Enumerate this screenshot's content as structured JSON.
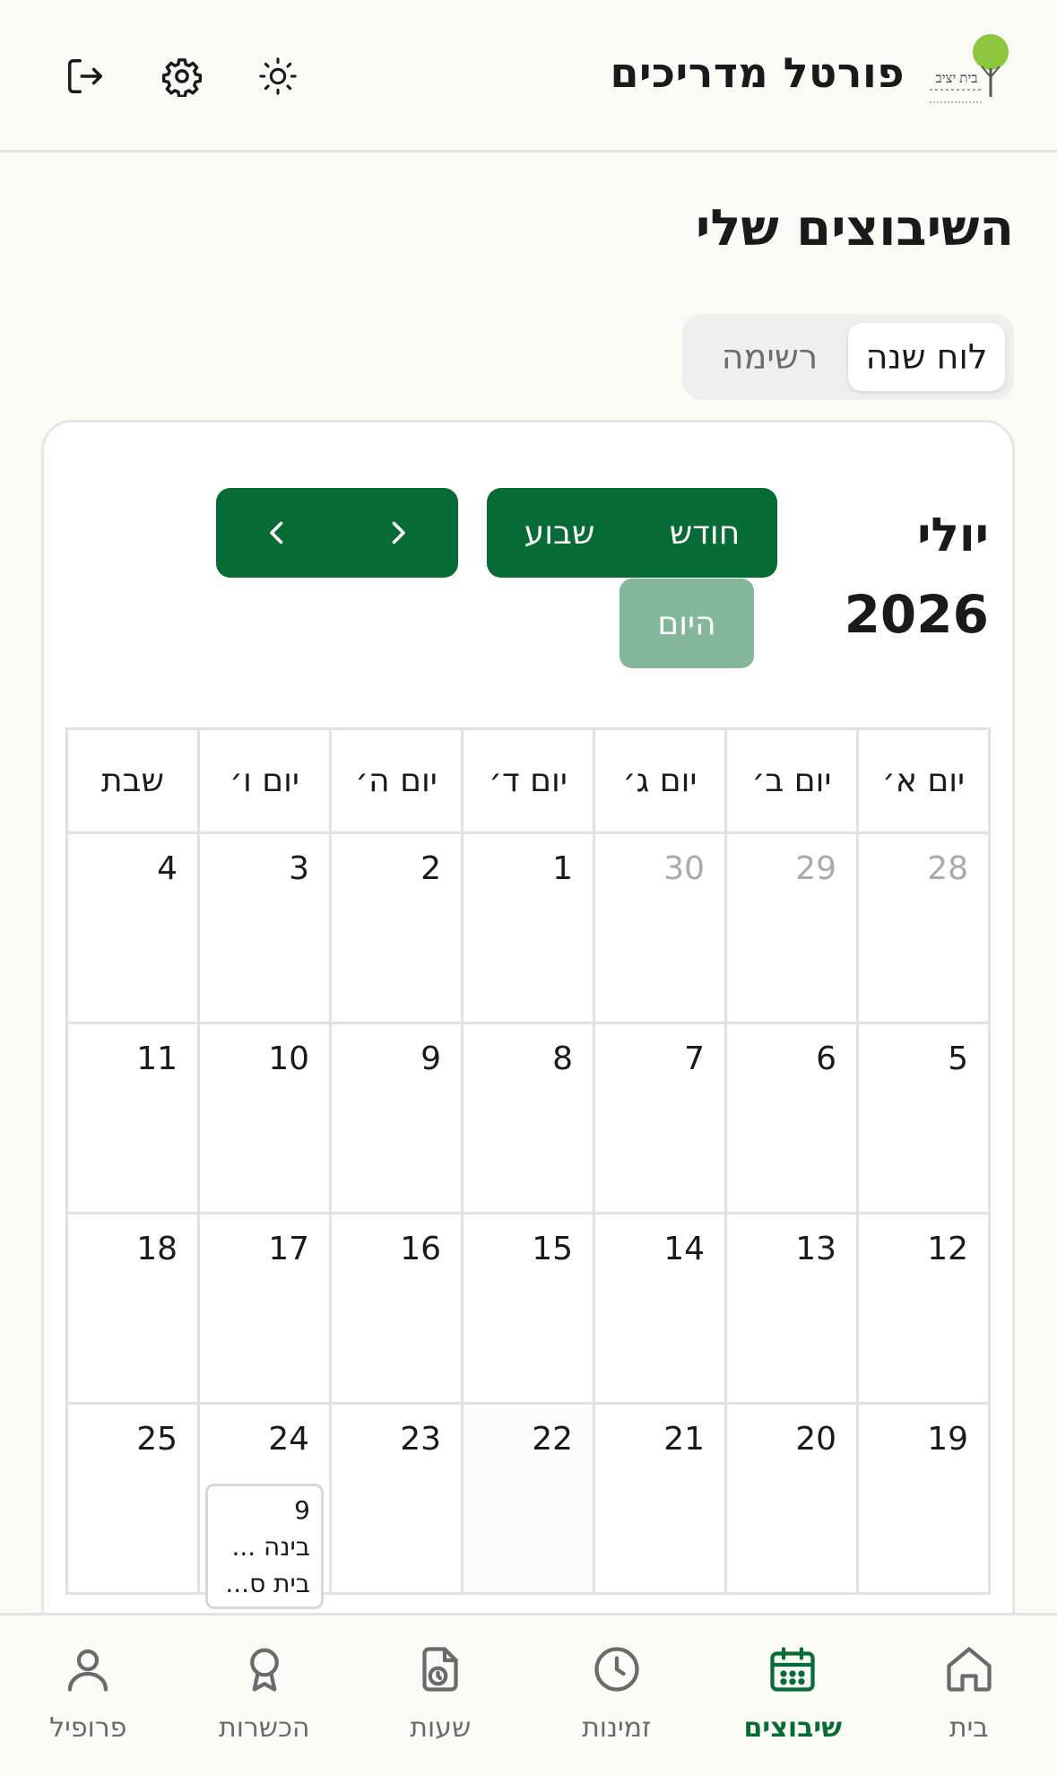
{
  "header": {
    "title": "פורטל מדריכים",
    "logo_text": "בית יציב",
    "icons": {
      "theme": "sun-icon",
      "settings": "gear-icon",
      "logout": "logout-icon"
    }
  },
  "page": {
    "title": "השיבוצים שלי"
  },
  "view_toggle": {
    "options": [
      {
        "label": "לוח שנה",
        "active": true
      },
      {
        "label": "רשימה",
        "active": false
      }
    ]
  },
  "calendar": {
    "month": "יולי",
    "year": "2026",
    "view_buttons": [
      "חודש",
      "שבוע"
    ],
    "today_label": "היום",
    "weekdays": [
      "יום א׳",
      "יום ב׳",
      "יום ג׳",
      "יום ד׳",
      "יום ה׳",
      "יום ו׳",
      "שבת"
    ],
    "weeks": [
      [
        {
          "day": "28",
          "outside": true
        },
        {
          "day": "29",
          "outside": true
        },
        {
          "day": "30",
          "outside": true
        },
        {
          "day": "1"
        },
        {
          "day": "2"
        },
        {
          "day": "3"
        },
        {
          "day": "4"
        }
      ],
      [
        {
          "day": "5"
        },
        {
          "day": "6"
        },
        {
          "day": "7"
        },
        {
          "day": "8"
        },
        {
          "day": "9"
        },
        {
          "day": "10"
        },
        {
          "day": "11"
        }
      ],
      [
        {
          "day": "12"
        },
        {
          "day": "13"
        },
        {
          "day": "14"
        },
        {
          "day": "15"
        },
        {
          "day": "16"
        },
        {
          "day": "17"
        },
        {
          "day": "18"
        }
      ],
      [
        {
          "day": "19"
        },
        {
          "day": "20"
        },
        {
          "day": "21"
        },
        {
          "day": "22",
          "shaded": true
        },
        {
          "day": "23"
        },
        {
          "day": "24",
          "event": {
            "line1": "9",
            "line2": "בינה ...",
            "line3": "בית ס..."
          }
        },
        {
          "day": "25"
        }
      ]
    ]
  },
  "bottom_nav": {
    "items": [
      {
        "label": "בית",
        "icon": "home-icon",
        "active": false
      },
      {
        "label": "שיבוצים",
        "icon": "calendar-icon",
        "active": true
      },
      {
        "label": "זמינות",
        "icon": "clock-icon",
        "active": false
      },
      {
        "label": "שעות",
        "icon": "timesheet-icon",
        "active": false
      },
      {
        "label": "הכשרות",
        "icon": "award-icon",
        "active": false
      },
      {
        "label": "פרופיל",
        "icon": "user-icon",
        "active": false
      }
    ]
  },
  "colors": {
    "primary": "#066b35",
    "primary_light": "#84b79a",
    "background": "#fbfbf6"
  }
}
